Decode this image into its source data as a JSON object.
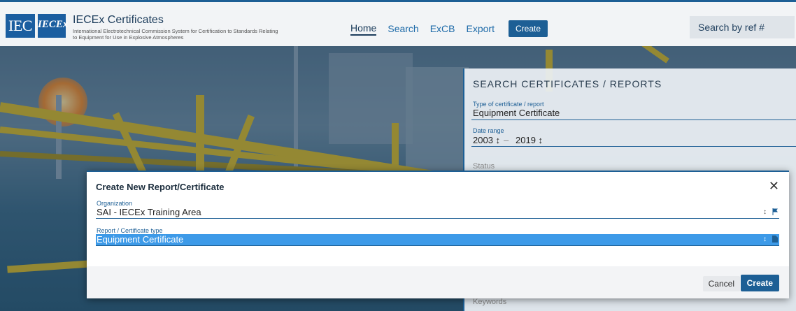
{
  "header": {
    "logo_iec": "IEC",
    "logo_iecex": "IECEx",
    "title": "IECEx Certificates",
    "subtitle": "International Electrotechnical Commission System for Certification to Standards Relating to Equipment for Use in Explosive Atmospheres",
    "nav": [
      "Home",
      "Search",
      "ExCB",
      "Export"
    ],
    "create_label": "Create",
    "search_placeholder": "Search by ref #"
  },
  "search_panel": {
    "title": "SEARCH CERTIFICATES / REPORTS",
    "type_label": "Type of certificate / report",
    "type_value": "Equipment Certificate",
    "date_label": "Date range",
    "date_from": "2003 ↕",
    "date_sep": "–",
    "date_to": "2019 ↕",
    "status_label": "Status",
    "keywords_label": "Keywords"
  },
  "modal": {
    "title": "Create New Report/Certificate",
    "close": "✕",
    "org_label": "Organization",
    "org_value": "SAI - IECEx Training Area",
    "type_label": "Report / Certificate type",
    "type_value": "Equipment Certificate",
    "arrows": "↕",
    "cancel_label": "Cancel",
    "create_label": "Create"
  },
  "colors": {
    "primary": "#1d5f95",
    "selection": "#3d9ae8",
    "structure_yellow": "#d9b92a"
  }
}
